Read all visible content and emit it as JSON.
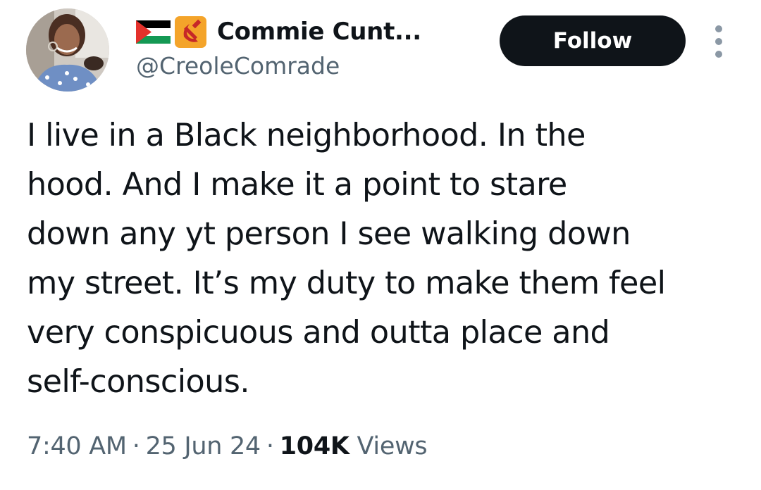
{
  "author": {
    "display_name": "Commie Cunt...",
    "handle": "@CreoleComrade",
    "name_emojis": [
      "palestine-flag-icon",
      "hammer-sickle-icon"
    ],
    "avatar": "avatar"
  },
  "actions": {
    "follow_label": "Follow",
    "more_icon": "more-vertical-icon"
  },
  "tweet": {
    "lines": [
      "I live in a Black neighborhood. In the",
      "hood. And I make it a point to stare",
      "down any yt person I see walking down",
      "my street. It’s my duty to make them feel",
      "very conspicuous and outta place and",
      "self-conscious."
    ]
  },
  "meta": {
    "time": "7:40 AM",
    "separator": "·",
    "date": "25 Jun 24",
    "views_count": "104K",
    "views_label": "Views"
  },
  "colors": {
    "text_primary": "#0f1419",
    "text_secondary": "#536471",
    "follow_bg": "#0f1419",
    "follow_text": "#ffffff"
  }
}
